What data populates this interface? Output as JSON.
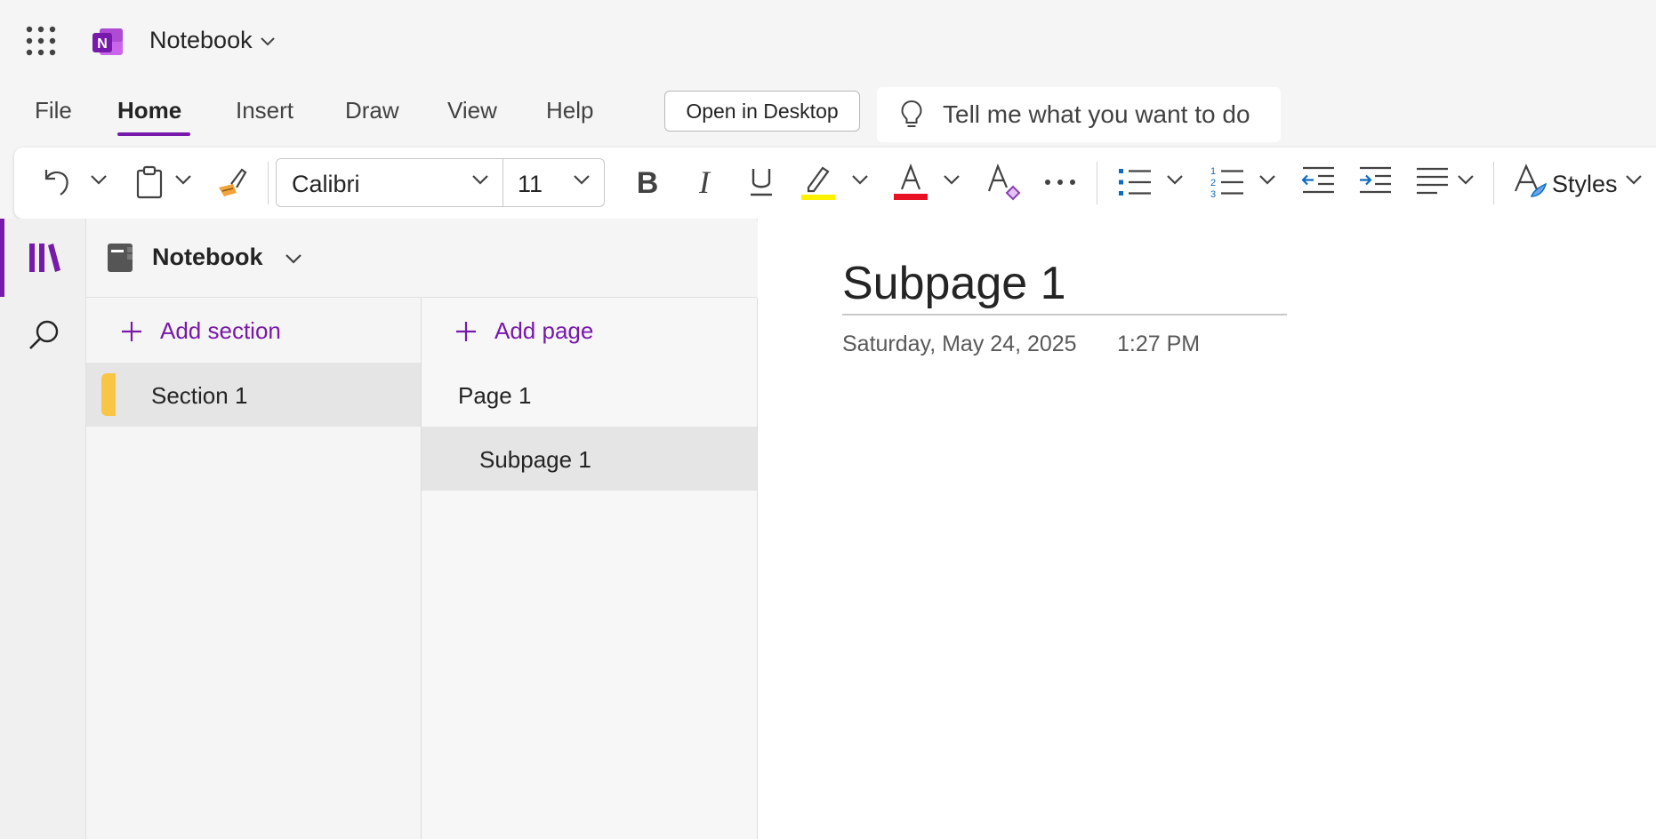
{
  "app": {
    "title": "Notebook"
  },
  "menu": {
    "tabs": [
      {
        "label": "File"
      },
      {
        "label": "Home"
      },
      {
        "label": "Insert"
      },
      {
        "label": "Draw"
      },
      {
        "label": "View"
      },
      {
        "label": "Help"
      }
    ],
    "active_tab": "Home",
    "open_in_desktop": "Open in Desktop",
    "tell_me": "Tell me what you want to do"
  },
  "ribbon": {
    "font_name": "Calibri",
    "font_size": "11",
    "styles_label": "Styles",
    "highlight_color": "#fff200",
    "font_color": "#e81123",
    "icons": [
      "undo-icon",
      "paste-icon",
      "format-painter-icon",
      "bold-icon",
      "italic-icon",
      "underline-icon",
      "highlight-icon",
      "font-color-icon",
      "clear-formatting-icon",
      "more-icon",
      "bullets-icon",
      "numbering-icon",
      "decrease-indent-icon",
      "increase-indent-icon",
      "align-icon",
      "styles-icon"
    ]
  },
  "navigation": {
    "notebook_title": "Notebook",
    "add_section": "Add section",
    "add_page": "Add page",
    "sections": [
      {
        "label": "Section 1",
        "color": "#f9c544"
      }
    ],
    "pages": [
      {
        "label": "Page 1"
      },
      {
        "label": "Subpage 1"
      }
    ]
  },
  "page": {
    "title": "Subpage 1",
    "date": "Saturday, May 24, 2025",
    "time": "1:27 PM"
  },
  "colors": {
    "accent": "#7719aa"
  }
}
